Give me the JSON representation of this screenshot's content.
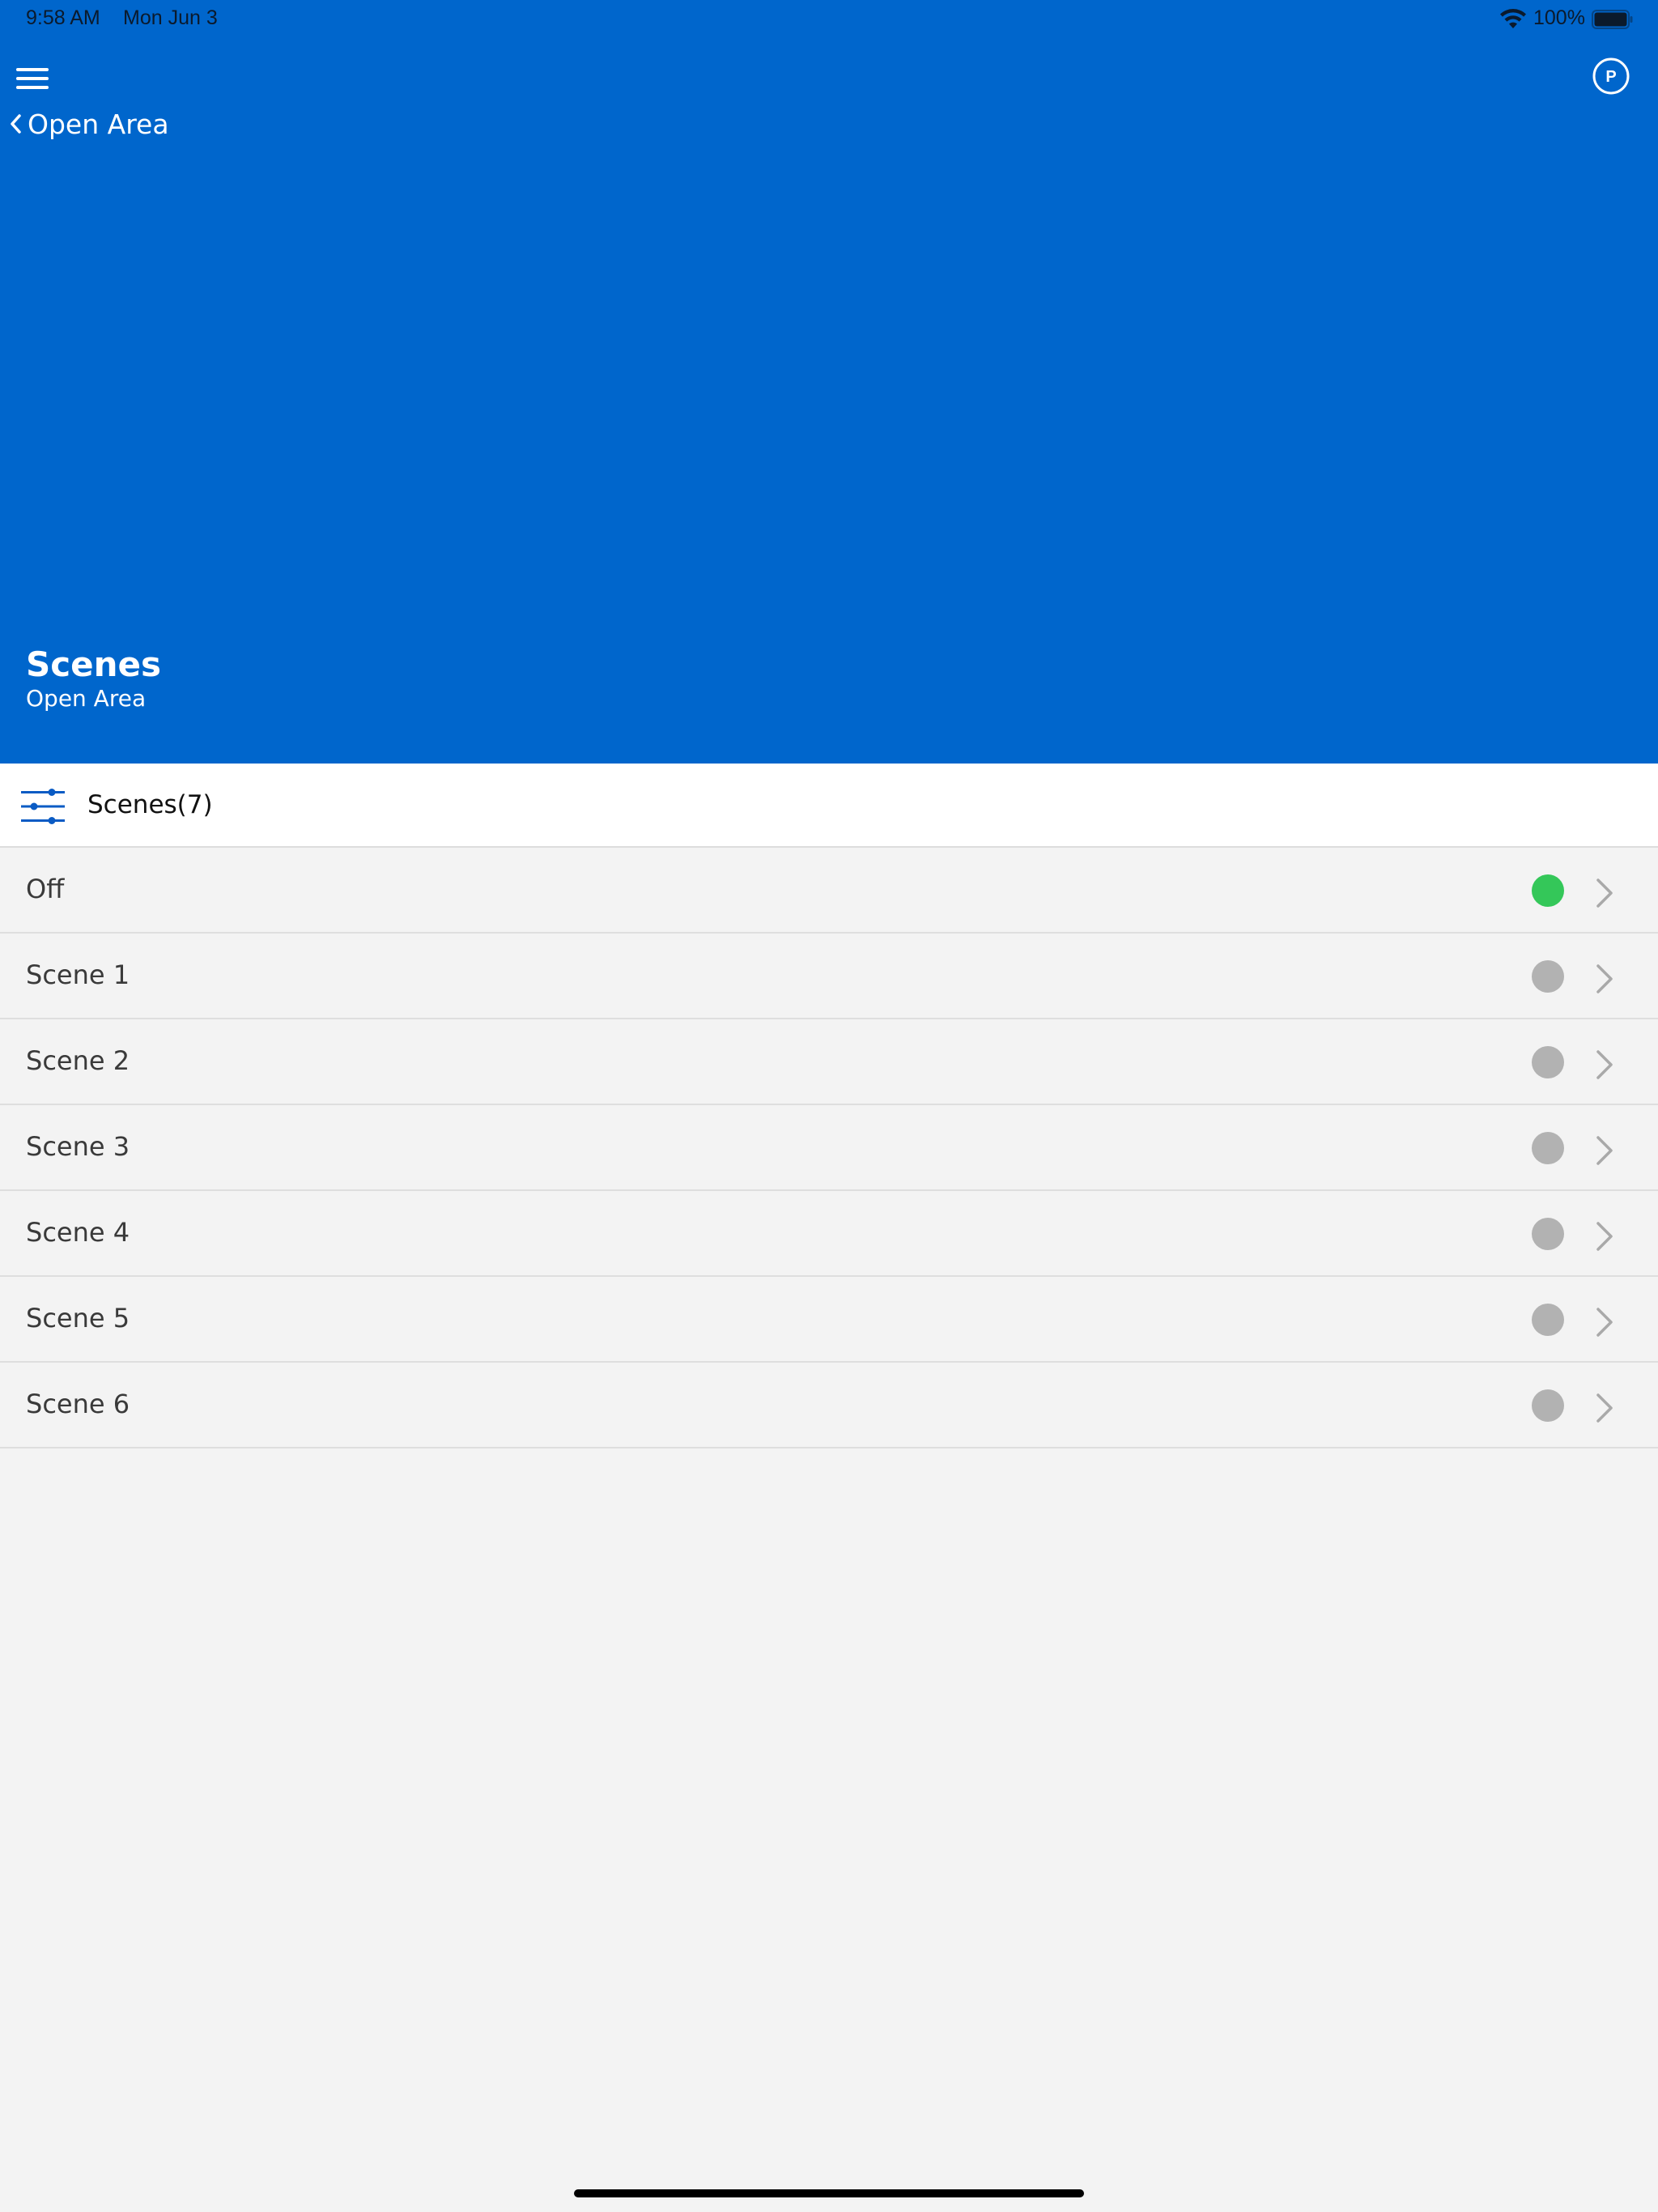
{
  "status_bar": {
    "time": "9:58 AM",
    "date": "Mon Jun 3",
    "battery_percent": "100%",
    "battery_level": 1.0
  },
  "header": {
    "menu_icon": "hamburger-menu-icon",
    "profile_icon": "profile-p-icon",
    "profile_letter": "P",
    "back_label": "Open Area",
    "title": "Scenes",
    "subtitle": "Open Area"
  },
  "section": {
    "filter_icon": "sliders-filter-icon",
    "title": "Scenes(7)"
  },
  "scenes": [
    {
      "label": "Off",
      "active": true
    },
    {
      "label": "Scene 1",
      "active": false
    },
    {
      "label": "Scene 2",
      "active": false
    },
    {
      "label": "Scene 3",
      "active": false
    },
    {
      "label": "Scene 4",
      "active": false
    },
    {
      "label": "Scene 5",
      "active": false
    },
    {
      "label": "Scene 6",
      "active": false
    }
  ],
  "colors": {
    "header_bg": "#0066cc",
    "accent": "#0a5bc4",
    "active_dot": "#34c759",
    "inactive_dot": "#b2b2b2",
    "chevron": "#a9a9a9",
    "background": "#f3f3f3"
  }
}
